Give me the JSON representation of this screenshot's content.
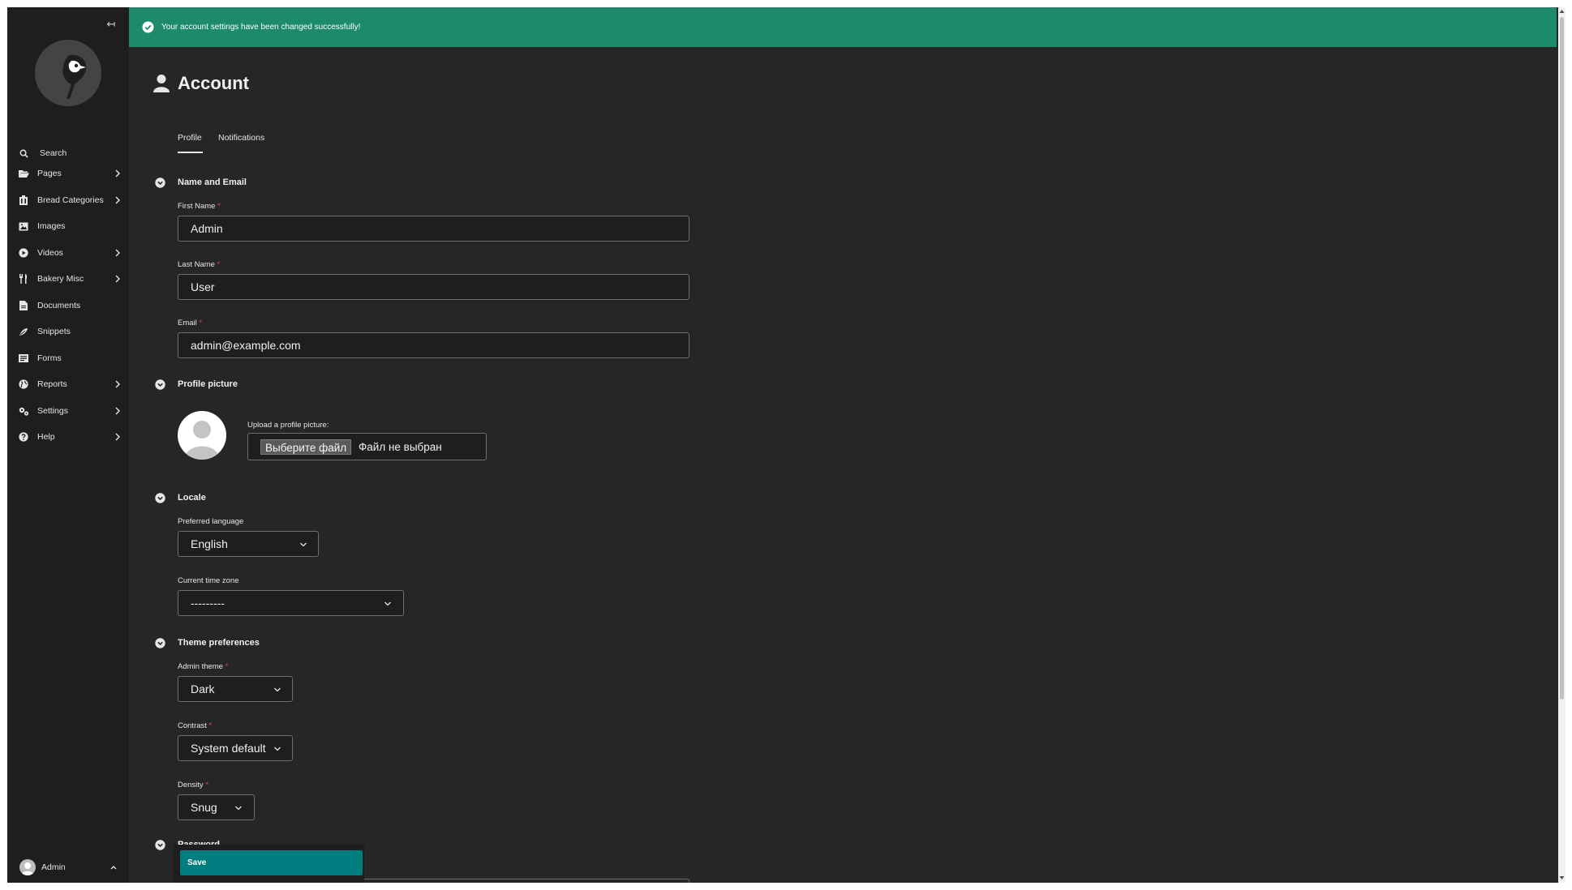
{
  "sidebar": {
    "collapse_icon": "collapse-sidebar-icon",
    "items": [
      {
        "label": "Search",
        "icon": "search-icon",
        "has_submenu": false
      },
      {
        "label": "Pages",
        "icon": "folder-open-icon",
        "has_submenu": true
      },
      {
        "label": "Bread Categories",
        "icon": "building-icon",
        "has_submenu": true
      },
      {
        "label": "Images",
        "icon": "image-icon",
        "has_submenu": false
      },
      {
        "label": "Videos",
        "icon": "play-circle-icon",
        "has_submenu": true
      },
      {
        "label": "Bakery Misc",
        "icon": "utensils-icon",
        "has_submenu": true
      },
      {
        "label": "Documents",
        "icon": "document-icon",
        "has_submenu": false
      },
      {
        "label": "Snippets",
        "icon": "snippet-icon",
        "has_submenu": false
      },
      {
        "label": "Forms",
        "icon": "form-icon",
        "has_submenu": false
      },
      {
        "label": "Reports",
        "icon": "globe-icon",
        "has_submenu": true
      },
      {
        "label": "Settings",
        "icon": "cogs-icon",
        "has_submenu": true
      },
      {
        "label": "Help",
        "icon": "help-icon",
        "has_submenu": true
      }
    ],
    "user": {
      "name": "Admin"
    }
  },
  "banner": {
    "message": "Your account settings have been changed successfully!",
    "color": "#1d8a6b"
  },
  "page": {
    "title": "Account",
    "tabs": [
      {
        "label": "Profile",
        "active": true
      },
      {
        "label": "Notifications",
        "active": false
      }
    ]
  },
  "sections": {
    "name_email": {
      "title": "Name and Email",
      "first_name": {
        "label": "First Name",
        "required_mark": "*",
        "value": "Admin"
      },
      "last_name": {
        "label": "Last Name",
        "required_mark": "*",
        "value": "User"
      },
      "email": {
        "label": "Email",
        "required_mark": "*",
        "value": "admin@example.com"
      }
    },
    "profile_picture": {
      "title": "Profile picture",
      "upload_label": "Upload a profile picture:",
      "choose_button": "Выберите файл",
      "file_status": "Файл не выбран"
    },
    "locale": {
      "title": "Locale",
      "language": {
        "label": "Preferred language",
        "value": "English"
      },
      "timezone": {
        "label": "Current time zone",
        "value": "---------"
      }
    },
    "theme": {
      "title": "Theme preferences",
      "admin_theme": {
        "label": "Admin theme",
        "required_mark": "*",
        "value": "Dark"
      },
      "contrast": {
        "label": "Contrast",
        "required_mark": "*",
        "value": "System default"
      },
      "density": {
        "label": "Density",
        "required_mark": "*",
        "value": "Snug"
      }
    },
    "password": {
      "title": "Password"
    }
  },
  "footer": {
    "save_label": "Save",
    "save_color": "#007d7e"
  }
}
